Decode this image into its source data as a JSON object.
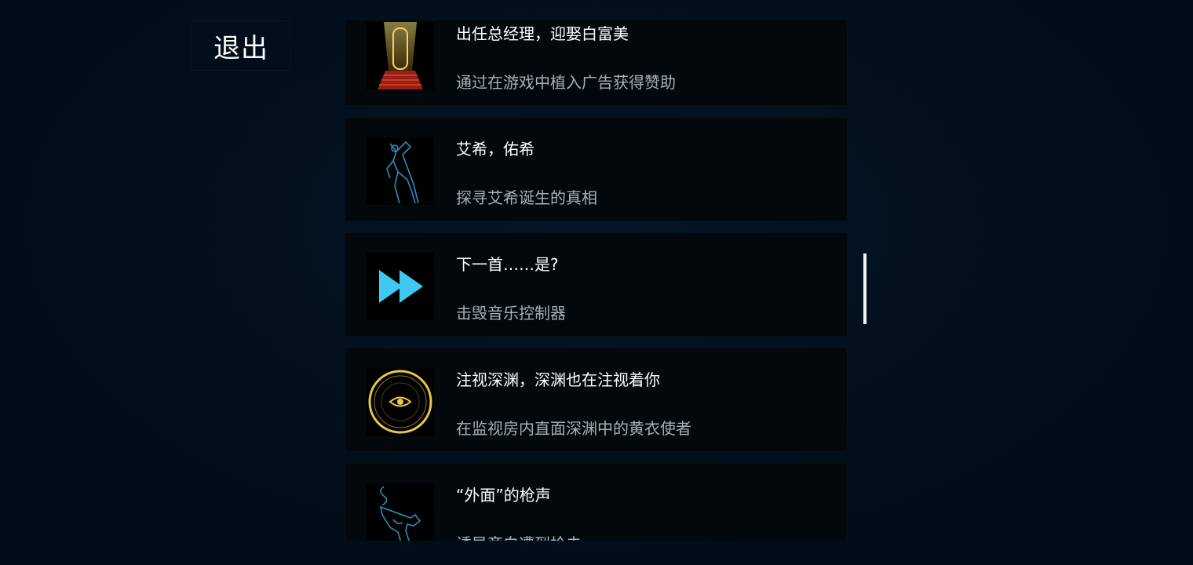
{
  "exit_button": {
    "label": "退出"
  },
  "achievements": [
    {
      "title": "出任总经理，迎娶白富美",
      "description": "通过在游戏中植入广告获得赞助",
      "icon": "golden-door-icon"
    },
    {
      "title": "艾希，佑希",
      "description": "探寻艾希诞生的真相",
      "icon": "blade-figure-icon"
    },
    {
      "title": "下一首……是?",
      "description": "击毁音乐控制器",
      "icon": "fast-forward-icon"
    },
    {
      "title": "注视深渊，深渊也在注视着你",
      "description": "在监视房内直面深渊中的黄衣使者",
      "icon": "eye-circle-icon"
    },
    {
      "title": "“外面”的枪声",
      "description": "诱导旁白遭到枪击",
      "icon": "smoking-gun-icon"
    }
  ],
  "colors": {
    "background": "#020d18",
    "card": "#02080c",
    "title": "#ffffff",
    "description": "#a9b0b5",
    "accent_gold": "#e8c84a",
    "accent_cyan": "#3fc9f0",
    "accent_blue": "#2a8fc0"
  }
}
